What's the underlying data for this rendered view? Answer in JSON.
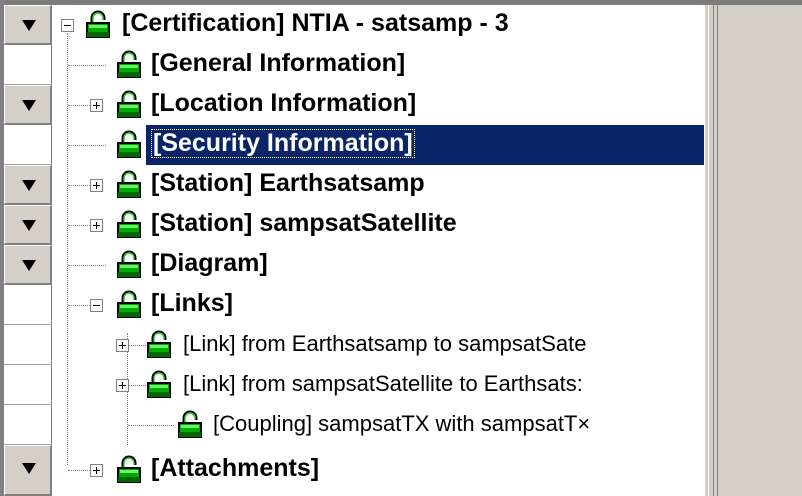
{
  "tree": {
    "root": {
      "label": "[Certification] NTIA - satsamp - 3"
    },
    "items": [
      {
        "label": "[General Information]"
      },
      {
        "label": "[Location Information]"
      },
      {
        "label": "[Security Information]"
      },
      {
        "label": "[Station] Earthsatsamp"
      },
      {
        "label": "[Station] sampsatSatellite"
      },
      {
        "label": "[Diagram]"
      },
      {
        "label": "[Links]"
      },
      {
        "label": "[Link] from Earthsatsamp to sampsatSate"
      },
      {
        "label": "[Link] from sampsatSatellite to Earthsats:"
      },
      {
        "label": "[Coupling] sampsatTX with sampsatT×"
      },
      {
        "label": "[Attachments]"
      }
    ],
    "selected_label": "[Security Information]"
  },
  "colors": {
    "selection": "#0a246a",
    "lock_icon": "#00aa00",
    "panel_gray": "#d4d0c8"
  },
  "icons": {
    "row_arrow": "triangle-down-icon",
    "node_icon": "green-lock-icon",
    "expand": "plus-box-icon",
    "collapse": "minus-box-icon"
  }
}
